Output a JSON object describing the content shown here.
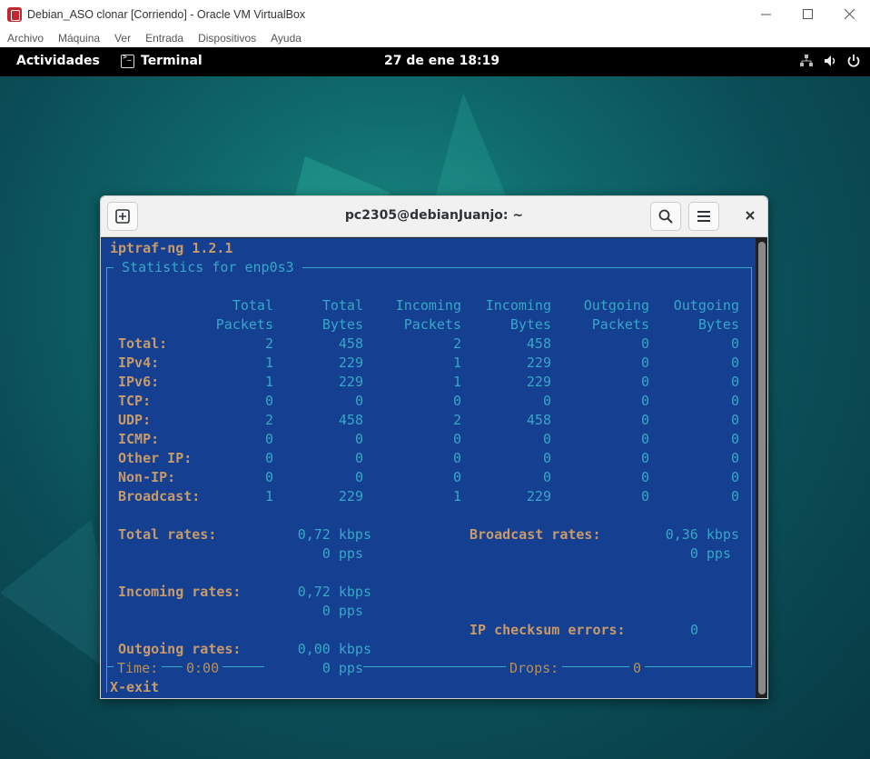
{
  "host": {
    "title": "Debian_ASO clonar [Corriendo] - Oracle VM VirtualBox",
    "menu": [
      "Archivo",
      "Máquina",
      "Ver",
      "Entrada",
      "Dispositivos",
      "Ayuda"
    ]
  },
  "topbar": {
    "activities": "Actividades",
    "app_name": "Terminal",
    "clock": "27 de ene  18:19"
  },
  "terminal": {
    "title": "pc2305@debianJuanjo: ~",
    "app_header": "iptraf-ng 1.2.1",
    "panel_title": " Statistics for enp0s3 ",
    "columns": [
      {
        "line1": "Total",
        "line2": "Packets"
      },
      {
        "line1": "Total",
        "line2": "Bytes"
      },
      {
        "line1": "Incoming",
        "line2": "Packets"
      },
      {
        "line1": "Incoming",
        "line2": "Bytes"
      },
      {
        "line1": "Outgoing",
        "line2": "Packets"
      },
      {
        "line1": "Outgoing",
        "line2": "Bytes"
      }
    ],
    "rows": [
      {
        "label": "Total:",
        "values": [
          "2",
          "458",
          "2",
          "458",
          "0",
          "0"
        ]
      },
      {
        "label": "IPv4:",
        "values": [
          "1",
          "229",
          "1",
          "229",
          "0",
          "0"
        ]
      },
      {
        "label": "IPv6:",
        "values": [
          "1",
          "229",
          "1",
          "229",
          "0",
          "0"
        ]
      },
      {
        "label": "TCP:",
        "values": [
          "0",
          "0",
          "0",
          "0",
          "0",
          "0"
        ]
      },
      {
        "label": "UDP:",
        "values": [
          "2",
          "458",
          "2",
          "458",
          "0",
          "0"
        ]
      },
      {
        "label": "ICMP:",
        "values": [
          "0",
          "0",
          "0",
          "0",
          "0",
          "0"
        ]
      },
      {
        "label": "Other IP:",
        "values": [
          "0",
          "0",
          "0",
          "0",
          "0",
          "0"
        ]
      },
      {
        "label": "Non-IP:",
        "values": [
          "0",
          "0",
          "0",
          "0",
          "0",
          "0"
        ]
      },
      {
        "label": "Broadcast:",
        "values": [
          "1",
          "229",
          "1",
          "229",
          "0",
          "0"
        ]
      }
    ],
    "rates": {
      "total_label": "Total rates:",
      "total_kbps": "0,72 kbps",
      "total_pps": "0 pps",
      "broadcast_label": "Broadcast rates:",
      "broadcast_kbps": "0,36 kbps",
      "broadcast_pps": "0 pps",
      "incoming_label": "Incoming rates:",
      "incoming_kbps": "0,72 kbps",
      "incoming_pps": "0 pps",
      "checksum_label": "IP checksum errors:",
      "checksum_value": "0",
      "outgoing_label": "Outgoing rates:",
      "outgoing_kbps": "0,00 kbps",
      "outgoing_pps": "0 pps"
    },
    "footer": {
      "time_label": "Time:",
      "time_value": "0:00",
      "drops_label": "Drops:",
      "drops_value": "0",
      "exit_hint": "X-exit"
    }
  }
}
